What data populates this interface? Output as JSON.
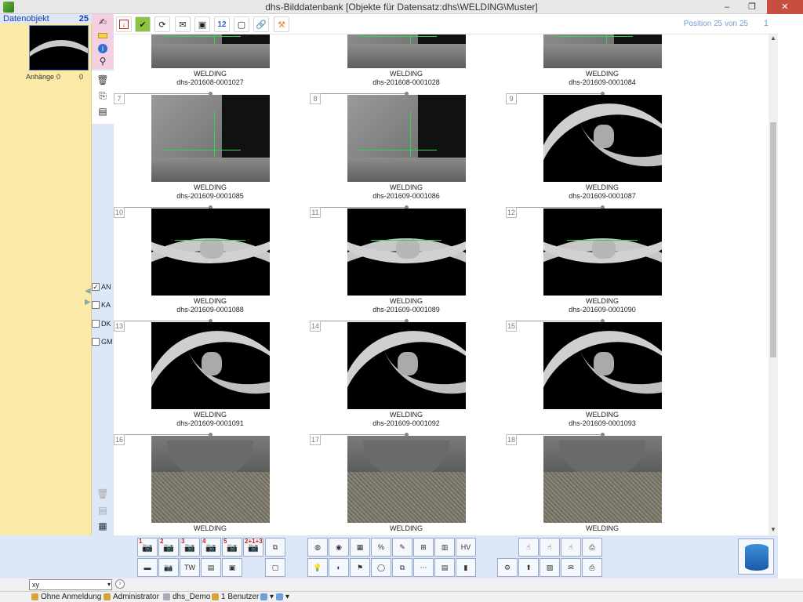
{
  "window": {
    "title": "dhs-Bilddatenbank [Objekte für Datensatz:dhs\\WELDING\\Muster]",
    "min": "–",
    "max": "❐",
    "close": "✕"
  },
  "left_panel": {
    "title": "Datenobjekt",
    "count": "25",
    "attachments_label": "Anhänge",
    "attachments_a": "0",
    "attachments_b": "0"
  },
  "filters": [
    {
      "label": "AN",
      "checked": "✓"
    },
    {
      "label": "KA",
      "checked": ""
    },
    {
      "label": "DK",
      "checked": ""
    },
    {
      "label": "GM",
      "checked": ""
    }
  ],
  "header": {
    "position_text": "Position 25 von 25",
    "page": "1"
  },
  "tiles": [
    {
      "num": "",
      "cat": "WELDING",
      "id": "dhs-201608-0001027",
      "kind": "fillet"
    },
    {
      "num": "",
      "cat": "WELDING",
      "id": "dhs-201608-0001028",
      "kind": "fillet"
    },
    {
      "num": "",
      "cat": "WELDING",
      "id": "dhs-201609-0001084",
      "kind": "fillet"
    },
    {
      "num": "7",
      "cat": "WELDING",
      "id": "dhs-201609-0001085",
      "kind": "fillet"
    },
    {
      "num": "8",
      "cat": "WELDING",
      "id": "dhs-201609-0001086",
      "kind": "fillet"
    },
    {
      "num": "9",
      "cat": "WELDING",
      "id": "dhs-201609-0001087",
      "kind": "diag"
    },
    {
      "num": "10",
      "cat": "WELDING",
      "id": "dhs-201609-0001088",
      "kind": "arcs"
    },
    {
      "num": "11",
      "cat": "WELDING",
      "id": "dhs-201609-0001089",
      "kind": "arcs"
    },
    {
      "num": "12",
      "cat": "WELDING",
      "id": "dhs-201609-0001090",
      "kind": "arcs"
    },
    {
      "num": "13",
      "cat": "WELDING",
      "id": "dhs-201609-0001091",
      "kind": "diag"
    },
    {
      "num": "14",
      "cat": "WELDING",
      "id": "dhs-201609-0001092",
      "kind": "diag"
    },
    {
      "num": "15",
      "cat": "WELDING",
      "id": "dhs-201609-0001093",
      "kind": "diag"
    },
    {
      "num": "16",
      "cat": "WELDING",
      "id": "",
      "kind": "macro"
    },
    {
      "num": "17",
      "cat": "WELDING",
      "id": "",
      "kind": "macro"
    },
    {
      "num": "18",
      "cat": "WELDING",
      "id": "",
      "kind": "macro"
    }
  ],
  "camera_buttons": [
    "1",
    "2",
    "3",
    "4",
    "5",
    "2+1+3"
  ],
  "combo": {
    "value": "xy",
    "arrow": "▾",
    "go": "›"
  },
  "status": {
    "login": "Ohne Anmeldung",
    "user": "Administrator",
    "db": "dhs_Demo",
    "users": "1 Benutzer"
  },
  "colors": {
    "accent": "#6f9fd8",
    "sidebar": "#fbe9a8",
    "panel": "#dce7f7"
  }
}
